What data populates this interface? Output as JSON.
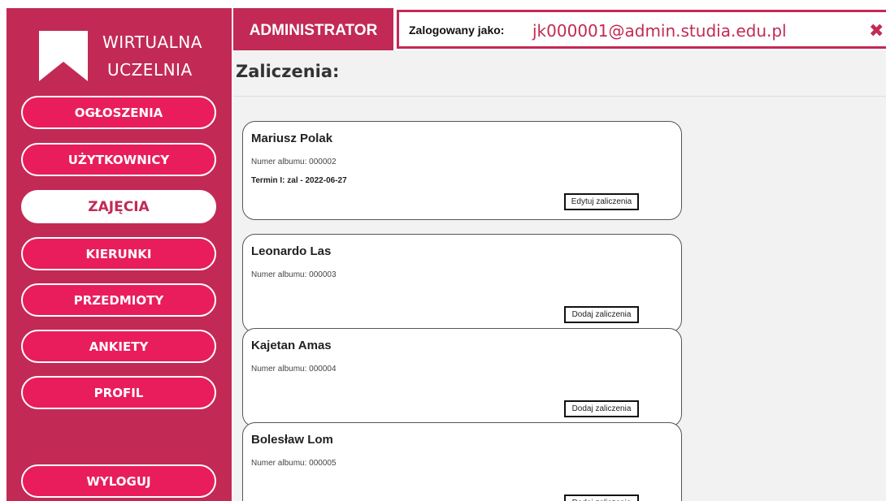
{
  "logo": {
    "line1": "WIRTUALNA",
    "line2": "UCZELNIA",
    "icon": "bookmark-icon"
  },
  "nav": [
    {
      "label": "OGŁOSZENIA",
      "active": false
    },
    {
      "label": "UŻYTKOWNICY",
      "active": false
    },
    {
      "label": "ZAJĘCIA",
      "active": true
    },
    {
      "label": "KIERUNKI",
      "active": false
    },
    {
      "label": "PRZEDMIOTY",
      "active": false
    },
    {
      "label": "ANKIETY",
      "active": false
    },
    {
      "label": "PROFIL",
      "active": false
    }
  ],
  "logout": {
    "label": "WYLOGUJ"
  },
  "header": {
    "role": "ADMINISTRATOR",
    "login_label": "Zalogowany jako:",
    "login_value": "jk000001@admin.studia.edu.pl",
    "close_glyph": "✖"
  },
  "main": {
    "title": "Zaliczenia:",
    "students": [
      {
        "name": "Mariusz Polak",
        "album": "Numer albumu: 000002",
        "term": "Termin I: zal - 2022-06-27",
        "button": "Edytuj zaliczenia"
      },
      {
        "name": "Leonardo Las",
        "album": "Numer albumu: 000003",
        "term": "",
        "button": "Dodaj zaliczenia"
      },
      {
        "name": "Kajetan Amas",
        "album": "Numer albumu: 000004",
        "term": "",
        "button": "Dodaj zaliczenia"
      },
      {
        "name": "Bolesław Lom",
        "album": "Numer albumu: 000005",
        "term": "",
        "button": "Dodaj zaliczenia"
      }
    ]
  },
  "colors": {
    "sidebar": "#c22a55",
    "button": "#e91d5c",
    "accent": "#c22a55",
    "main_bg": "#f2f2f2"
  }
}
